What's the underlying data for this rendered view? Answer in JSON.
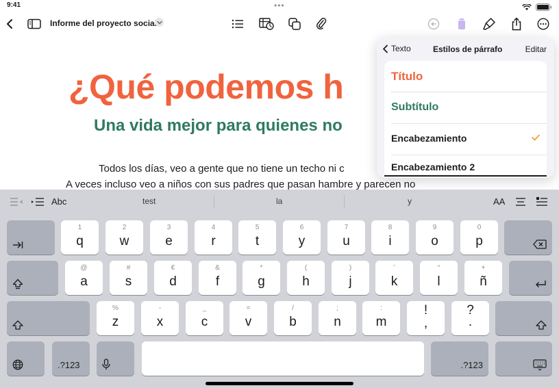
{
  "status_bar": {
    "time": "9:41",
    "dots": "•••"
  },
  "toolbar": {
    "document_title": "Informe del proyecto social",
    "icons": [
      "back-chevron-icon",
      "sidebar-icon",
      "list-icon",
      "table-chart-icon",
      "shapes-icon",
      "paperclip-icon",
      "undo-icon",
      "media-icon",
      "format-paintbrush-icon",
      "share-icon",
      "more-icon"
    ]
  },
  "document": {
    "heading": "¿Qué podemos h",
    "subheading": "Una vida mejor para quienes no",
    "line1": "Todos los días, veo a gente que no tiene un techo ni c",
    "line2": "A veces incluso veo a niños con sus padres que pasan hambre y parecen no"
  },
  "popover": {
    "back_label": "Texto",
    "title": "Estilos de párrafo",
    "edit_label": "Editar",
    "styles": [
      {
        "label": "Título",
        "color": "#f0633e",
        "selected": false
      },
      {
        "label": "Subtítulo",
        "color": "#2f7a63",
        "selected": false
      },
      {
        "label": "Encabezamiento",
        "color": "#1c1c1e",
        "selected": true
      },
      {
        "label": "Encabezamiento 2",
        "color": "#1c1c1e",
        "selected": false
      }
    ],
    "check_color": "#f0a030"
  },
  "keyboard": {
    "suggestions": [
      "test",
      "la",
      "y"
    ],
    "abc_label": "Abc",
    "aa_label": "AA",
    "row1": [
      {
        "sec": "1",
        "pri": "q"
      },
      {
        "sec": "2",
        "pri": "w"
      },
      {
        "sec": "3",
        "pri": "e"
      },
      {
        "sec": "4",
        "pri": "r"
      },
      {
        "sec": "5",
        "pri": "t"
      },
      {
        "sec": "6",
        "pri": "y"
      },
      {
        "sec": "7",
        "pri": "u"
      },
      {
        "sec": "8",
        "pri": "i"
      },
      {
        "sec": "9",
        "pri": "o"
      },
      {
        "sec": "0",
        "pri": "p"
      }
    ],
    "row2": [
      {
        "sec": "@",
        "pri": "a"
      },
      {
        "sec": "#",
        "pri": "s"
      },
      {
        "sec": "€",
        "pri": "d"
      },
      {
        "sec": "&",
        "pri": "f"
      },
      {
        "sec": "*",
        "pri": "g"
      },
      {
        "sec": "(",
        "pri": "h"
      },
      {
        "sec": ")",
        "pri": "j"
      },
      {
        "sec": "’",
        "pri": "k"
      },
      {
        "sec": "“",
        "pri": "l"
      },
      {
        "sec": "+",
        "pri": "ñ"
      }
    ],
    "row3": [
      {
        "sec": "%",
        "pri": "z"
      },
      {
        "sec": "-",
        "pri": "x"
      },
      {
        "sec": "_",
        "pri": "c"
      },
      {
        "sec": "=",
        "pri": "v"
      },
      {
        "sec": "/",
        "pri": "b"
      },
      {
        "sec": ";",
        "pri": "n"
      },
      {
        "sec": ":",
        "pri": "m"
      },
      {
        "sec": "!",
        "pri": ","
      },
      {
        "sec": "?",
        "pri": "."
      }
    ],
    "numbers_label": ".?123"
  }
}
